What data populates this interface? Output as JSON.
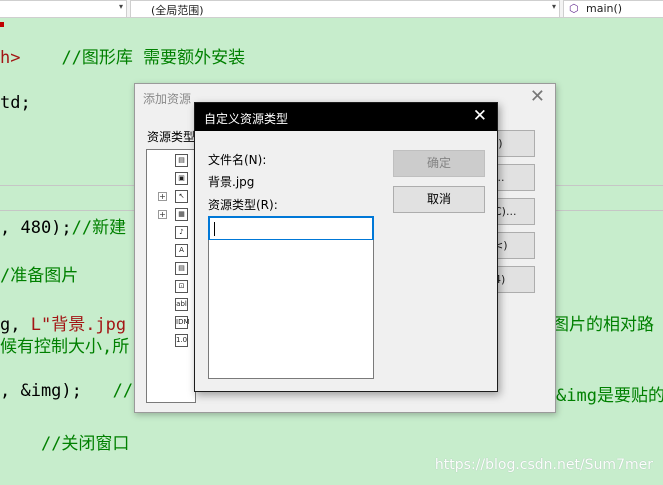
{
  "toolbar": {
    "scope_dropdown": "(全局范围)",
    "function_dropdown": "main()",
    "dropdown_arrow": "▾"
  },
  "code": {
    "line1_include": "h>",
    "line1_comment": "//图形库 需要额外安装",
    "line2": "td;",
    "line3_code": ", 480);",
    "line3_comment": "//新建",
    "line4_comment": "/准备图片",
    "line5_code": "g, ",
    "line5_string": "L\"背景.jpg",
    "line5_comment": "图片的相对路",
    "line6_comment": "候有控制大小,所",
    "line7_code": ", &img);",
    "line7_comment": "//",
    "line7_tail": "&img是要贴的",
    "line8_comment": "//关闭窗口"
  },
  "watermark": "https://blog.csdn.net/Sum7mer",
  "add_resource_dialog": {
    "title": "添加资源",
    "resource_type_label": "资源类型",
    "close_glyph": "✕",
    "buttons": [
      "()",
      "...",
      "C)...",
      "<)",
      "4)"
    ],
    "tree_icons": [
      "▤",
      "▣",
      "↖",
      "▦",
      "♪",
      "A",
      "▤",
      "⊡",
      "abl",
      "IDM",
      "1.0"
    ]
  },
  "custom_dialog": {
    "title": "自定义资源类型",
    "close_glyph": "✕",
    "filename_label": "文件名(N):",
    "filename_value": "背景.jpg",
    "resource_type_label": "资源类型(R):",
    "resource_type_value": "",
    "ok_label": "确定",
    "cancel_label": "取消"
  }
}
